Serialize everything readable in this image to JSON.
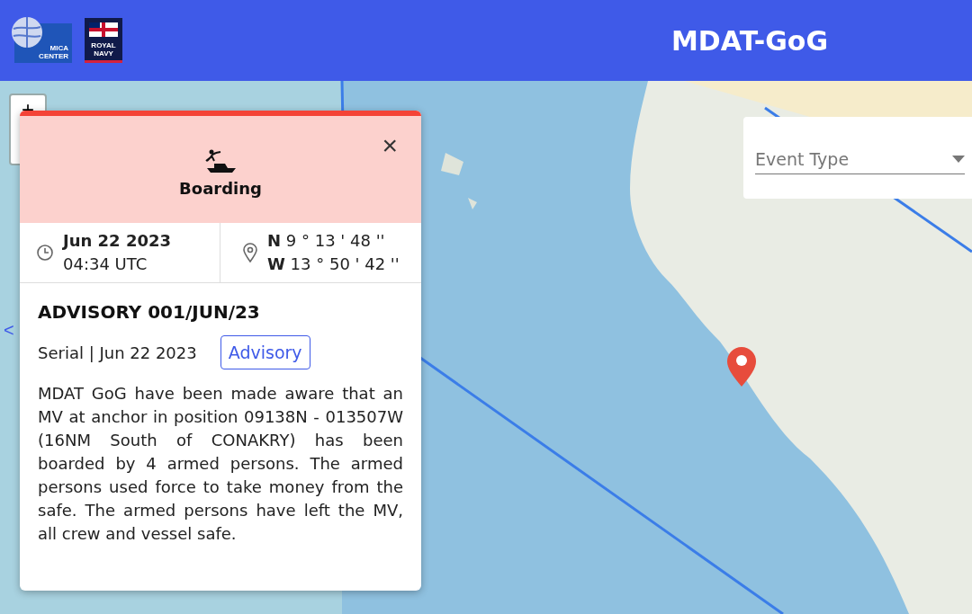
{
  "header": {
    "logos": [
      {
        "kind": "mica",
        "lines": [
          "MICA",
          "CENTER"
        ]
      },
      {
        "kind": "navy",
        "lines": [
          "ROYAL",
          "NAVY"
        ]
      }
    ],
    "title": "MDAT-GoG"
  },
  "map": {
    "zoom_control": {
      "label": "+"
    },
    "side_toggle": "<",
    "filter": {
      "placeholder": "Event Type"
    }
  },
  "popup": {
    "event": {
      "kind": "boarding",
      "label": "Boarding",
      "color": "#f44336"
    },
    "close": "×",
    "date": "Jun 22 2023",
    "time": "04:34 UTC",
    "lat": {
      "hemisphere": "N",
      "value": "9 ° 13 ' 48 ''"
    },
    "lon": {
      "hemisphere": "W",
      "value": "13 ° 50 ' 42 ''"
    },
    "title": "ADVISORY 001/JUN/23",
    "meta": "Serial | Jun 22 2023",
    "tag": "Advisory",
    "description": "MDAT GoG have been made aware that an MV at anchor in position 09138N - 013507W (16NM South of CONAKRY) has been boarded by 4 armed persons. The armed persons used force to take money from the safe. The armed persons have left the MV, all crew and vessel safe."
  }
}
